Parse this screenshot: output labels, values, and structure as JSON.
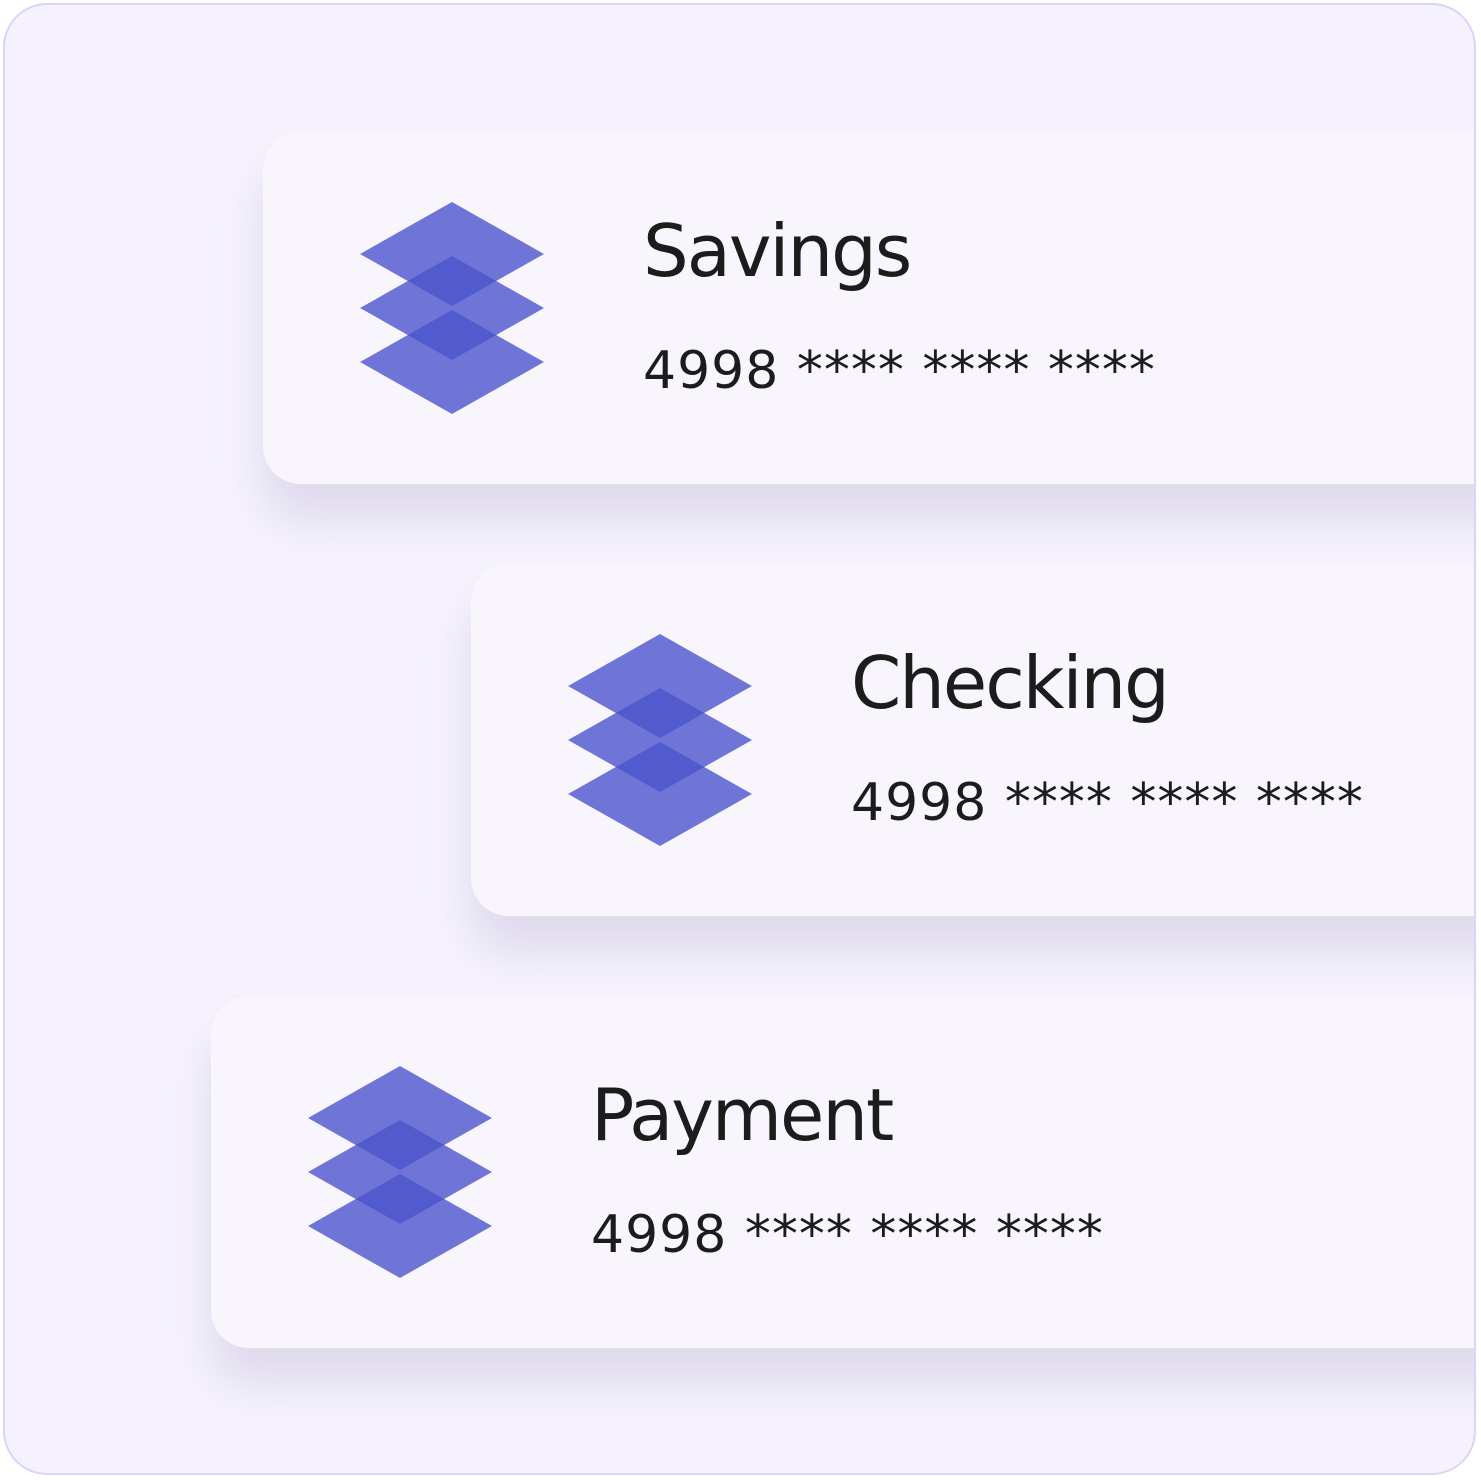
{
  "accounts": [
    {
      "name": "Savings",
      "number": "4998 **** **** ****",
      "icon": "stacked-layers-icon"
    },
    {
      "name": "Checking",
      "number": "4998 **** **** ****",
      "icon": "stacked-layers-icon"
    },
    {
      "name": "Payment",
      "number": "4998 **** **** ****",
      "icon": "stacked-layers-icon"
    }
  ],
  "colors": {
    "background": "#f5f2fd",
    "border": "#ddd3f6",
    "card": "#f8f6fc",
    "icon": "#4b55cc",
    "text": "#1c1c1c"
  }
}
